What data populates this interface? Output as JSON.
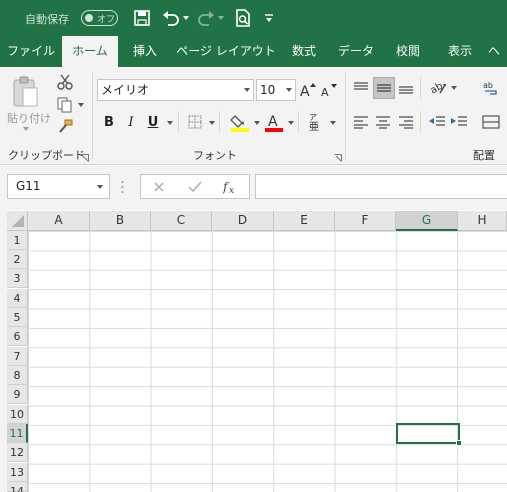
{
  "title_bar": {
    "autosave_label": "自動保存",
    "autosave_state": "オフ",
    "icons": [
      "save-icon",
      "undo-icon",
      "redo-icon",
      "print-preview-icon",
      "customize-qat-icon"
    ]
  },
  "tabs": [
    {
      "label": "ファイル",
      "active": false
    },
    {
      "label": "ホーム",
      "active": true
    },
    {
      "label": "挿入",
      "active": false
    },
    {
      "label": "ページ レイアウト",
      "active": false
    },
    {
      "label": "数式",
      "active": false
    },
    {
      "label": "データ",
      "active": false
    },
    {
      "label": "校閲",
      "active": false
    },
    {
      "label": "表示",
      "active": false
    },
    {
      "label": "ヘ",
      "active": false
    }
  ],
  "ribbon": {
    "clipboard": {
      "paste_label": "貼り付け",
      "group_label": "クリップボード"
    },
    "font": {
      "font_name": "メイリオ",
      "font_size": "10",
      "bold": "B",
      "italic": "I",
      "underline": "U",
      "group_label": "フォント",
      "fill_color": "#FFFF00",
      "font_color": "#FF0000"
    },
    "alignment": {
      "group_label": "配置"
    }
  },
  "formula_bar": {
    "name_box": "G11",
    "formula": ""
  },
  "grid": {
    "columns": [
      "A",
      "B",
      "C",
      "D",
      "E",
      "F",
      "G",
      "H"
    ],
    "rows": [
      "1",
      "2",
      "3",
      "4",
      "5",
      "6",
      "7",
      "8",
      "9",
      "10",
      "11",
      "12",
      "13",
      "14"
    ],
    "selected_cell": "G11"
  },
  "colors": {
    "accent": "#217346",
    "ribbon_bg": "#F3F3F3",
    "header_bg": "#E6E6E6"
  }
}
